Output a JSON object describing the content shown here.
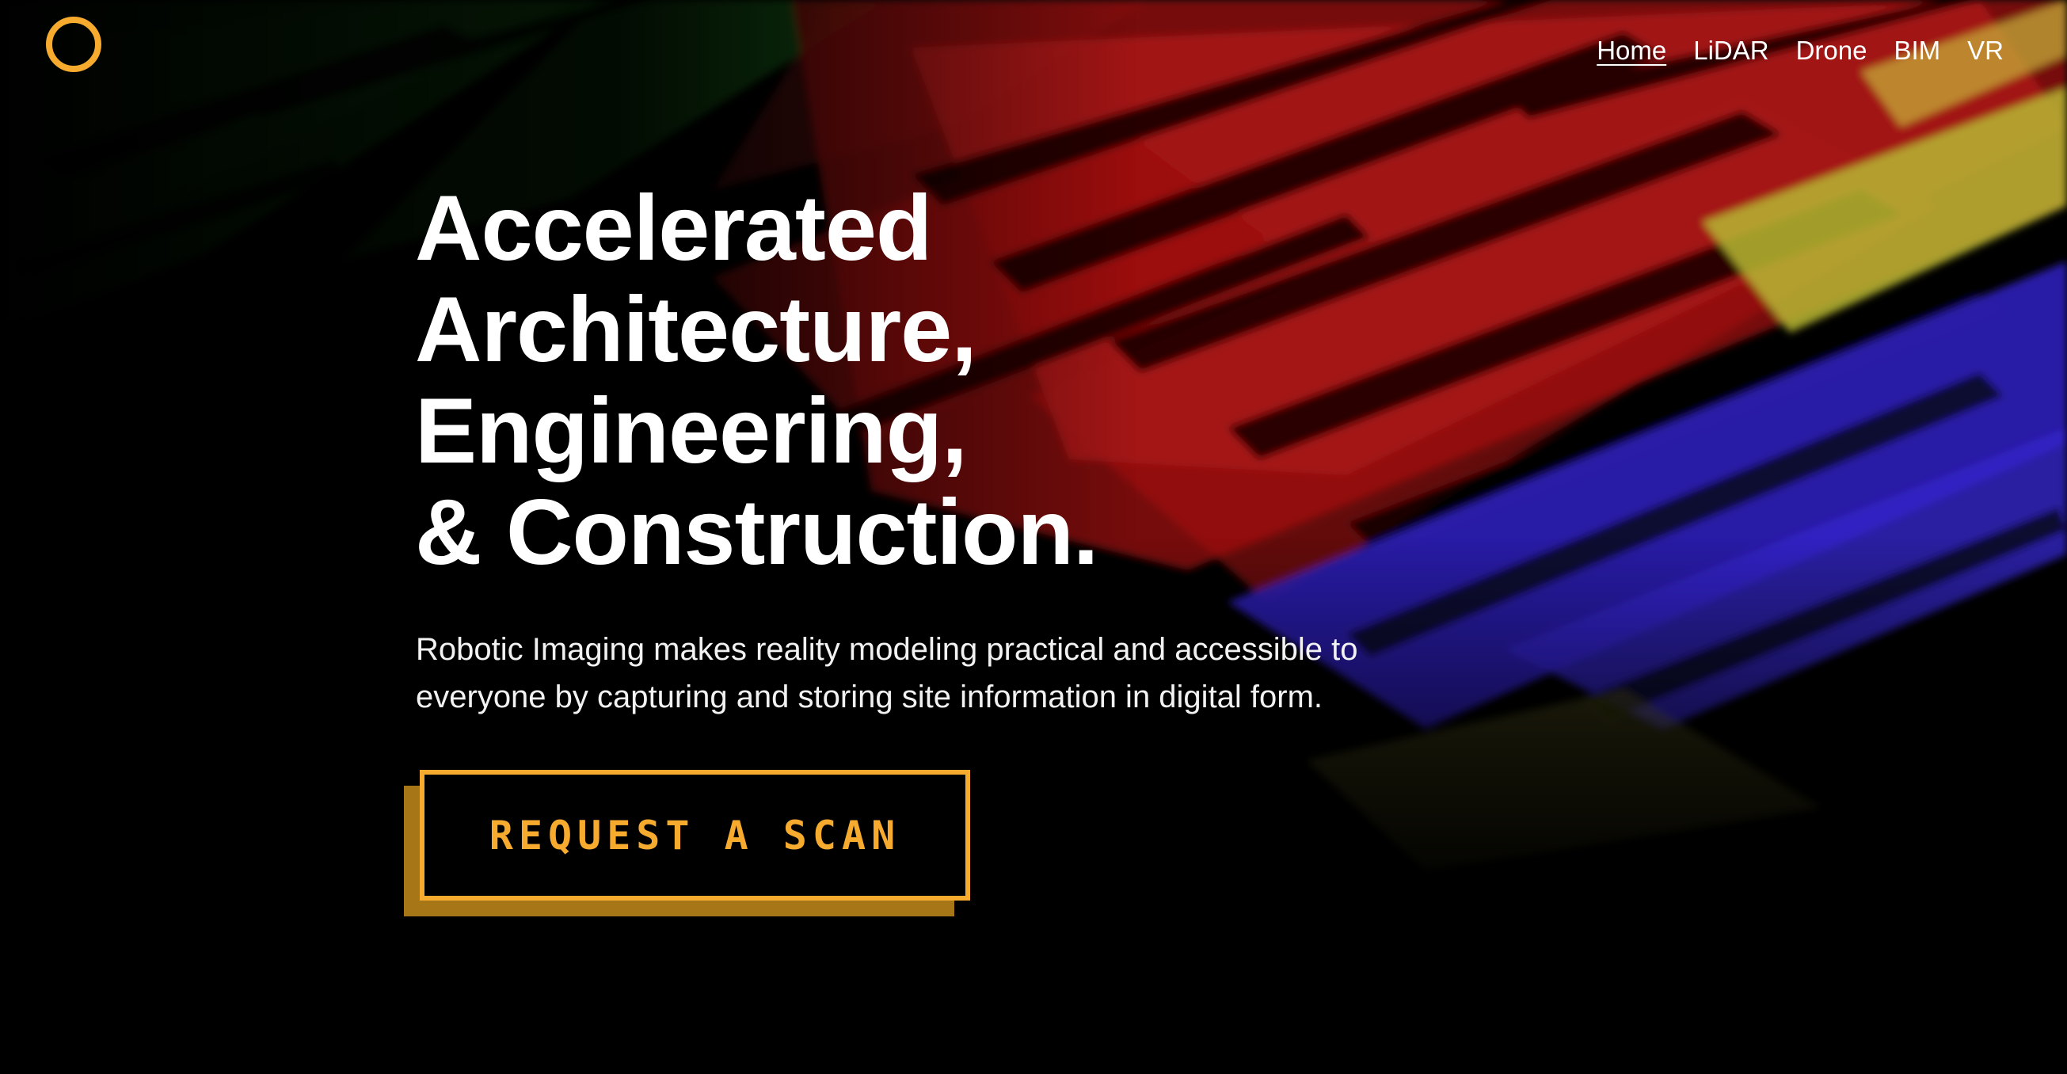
{
  "colors": {
    "accent": "#f6ab2f",
    "accent_shadow": "#a67617",
    "background": "#000000",
    "text": "#ffffff"
  },
  "logo": {
    "icon": "ring-logo-icon"
  },
  "nav": {
    "items": [
      {
        "label": "Home",
        "active": true
      },
      {
        "label": "LiDAR",
        "active": false
      },
      {
        "label": "Drone",
        "active": false
      },
      {
        "label": "BIM",
        "active": false
      },
      {
        "label": "VR",
        "active": false
      }
    ]
  },
  "hero": {
    "headline_lines": [
      "Accelerated",
      "Architecture,",
      "Engineering,",
      "& Construction."
    ],
    "subtext_lines": [
      "Robotic Imaging makes reality modeling practical and accessible to",
      "everyone by capturing and storing site information in digital form."
    ],
    "cta_label": "REQUEST A SCAN"
  }
}
